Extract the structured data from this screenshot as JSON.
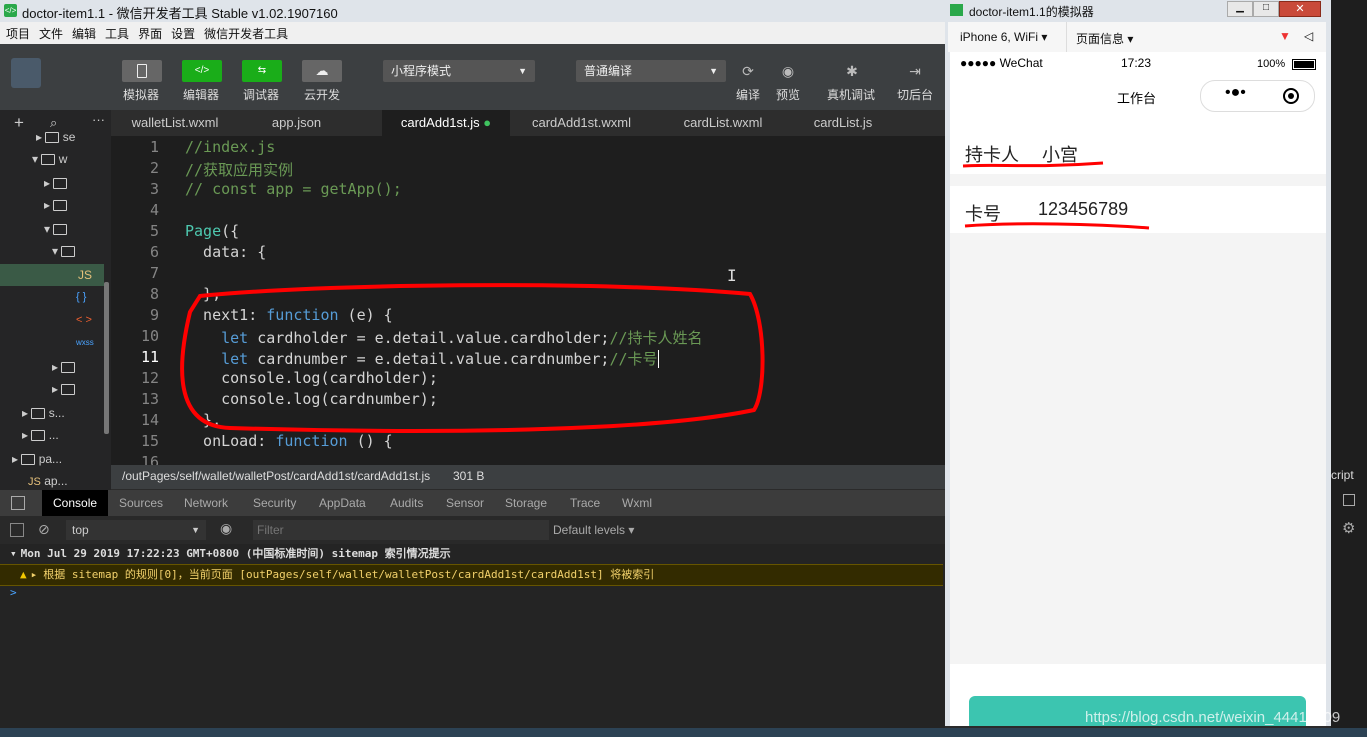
{
  "window": {
    "title": "doctor-item1.1 - 微信开发者工具 Stable v1.02.1907160",
    "app_icon": "code-icon"
  },
  "menu": [
    "项目",
    "文件",
    "编辑",
    "工具",
    "界面",
    "设置",
    "微信开发者工具"
  ],
  "toolbar": {
    "simulator": "模拟器",
    "editor": "编辑器",
    "debugger": "调试器",
    "cloud": "云开发",
    "mode": "小程序模式",
    "compile_mode": "普通编译",
    "compile": "编译",
    "preview": "预览",
    "remote_debug": "真机调试",
    "background": "切后台",
    "accent": "#1aad19"
  },
  "tabs": [
    "walletList.wxml",
    "app.json",
    "cardAdd1st.js",
    "cardAdd1st.wxml",
    "cardList.wxml",
    "cardList.js"
  ],
  "sidebar": {
    "sel_label": "JS",
    "items": [
      "se",
      "w",
      "JS",
      "{ }",
      "< >",
      "wxss",
      "s...",
      "...",
      "pa...",
      "ap..."
    ]
  },
  "code": {
    "line_numbers": [
      "1",
      "2",
      "3",
      "4",
      "5",
      "6",
      "7",
      "8",
      "9",
      "10",
      "11",
      "12",
      "13",
      "14",
      "15",
      "16"
    ],
    "l1": "//index.js",
    "l2": "//获取应用实例",
    "l3": "// const app = getApp();",
    "l5": "Page",
    "l5b": "({",
    "l6": "  data: {",
    "l8": "  },",
    "l9a": "  next1: ",
    "l9b": "function",
    "l9c": " (e) {",
    "l10a": "    ",
    "l10b": "let",
    "l10c": " cardholder = e.detail.value.cardholder;",
    "l10d": "//持卡人姓名",
    "l11a": "    ",
    "l11b": "let",
    "l11c": " cardnumber = e.detail.value.cardnumber;",
    "l11d": "//卡号",
    "l12": "    console.log(cardholder);",
    "l13": "    console.log(cardnumber);",
    "l14": "  },",
    "l15a": "  onLoad: ",
    "l15b": "function",
    "l15c": " () {"
  },
  "status": {
    "path": "/outPages/self/wallet/walletPost/cardAdd1st/cardAdd1st.js",
    "size": "301 B",
    "right": "cript"
  },
  "devtools": {
    "tabs": [
      "Console",
      "Sources",
      "Network",
      "Security",
      "AppData",
      "Audits",
      "Sensor",
      "Storage",
      "Trace",
      "Wxml"
    ],
    "context": "top",
    "filter_placeholder": "Filter",
    "levels": "Default levels",
    "log1": "Mon Jul 29 2019 17:22:23 GMT+0800 (中国标准时间) sitemap 索引情况提示",
    "log2": "根据 sitemap 的规则[0]，当前页面 [outPages/self/wallet/walletPost/cardAdd1st/cardAdd1st] 将被索引",
    "prompt": ">"
  },
  "simulator": {
    "title": "doctor-item1.1的模拟器",
    "device": "iPhone 6, WiFi",
    "page_info": "页面信息",
    "carrier": "●●●●● WeChat",
    "time": "17:23",
    "battery": "100%",
    "nav_title": "工作台",
    "holder_label": "持卡人",
    "holder_value": "小宫",
    "number_label": "卡号",
    "number_value": "123456789",
    "button_color": "#3cc5b0"
  },
  "watermark": "https://blog.csdn.net/weixin_44415209",
  "annotation_color": "#ff0000"
}
